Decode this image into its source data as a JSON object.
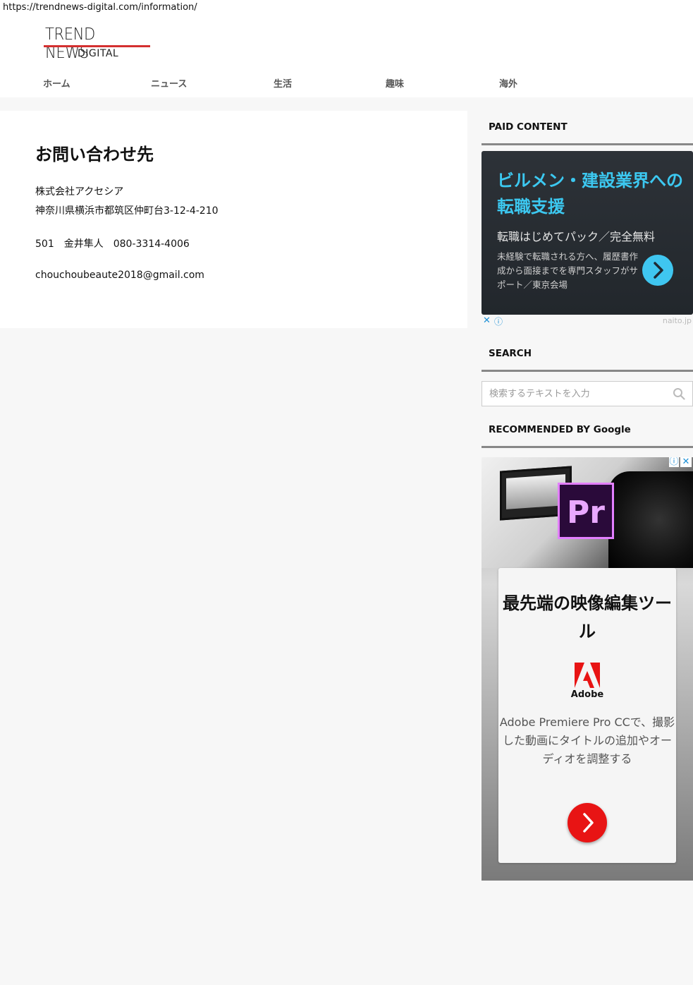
{
  "browser": {
    "url": "https://trendnews-digital.com/information/"
  },
  "site": {
    "logo_top": "TREND NEWS",
    "logo_bottom": "DIGITAL",
    "logo_accent": "#d43030"
  },
  "nav": {
    "items": [
      {
        "label": "ホーム"
      },
      {
        "label": "ニュース"
      },
      {
        "label": "生活"
      },
      {
        "label": "趣味"
      },
      {
        "label": "海外"
      }
    ]
  },
  "main": {
    "title": "お問い合わせ先",
    "company": "株式会社アクセシア",
    "address": "神奈川県横浜市都筑区仲町台3-12-4-210",
    "contact": "501　金井隼人　080-3314-4006",
    "email": "chouchoubeaute2018@gmail.com"
  },
  "sidebar": {
    "paid_content_title": "PAID CONTENT",
    "ad1": {
      "headline": "ビルメン・建設業界への転職支援",
      "sub": "転職はじめてパック／完全無料",
      "body": "未経験で転職される方へ、履歴書作成から面接までを専門スタッフがサポート／東京会場",
      "button_icon": "chevron-right-icon",
      "close": "✕",
      "info": "ⓘ",
      "brand": "naito.jp",
      "accent": "#3cc8f0"
    },
    "search_title": "SEARCH",
    "search": {
      "placeholder": "検索するテキストを入力",
      "icon": "search-icon"
    },
    "recommended_title": "RECOMMENDED BY Google",
    "ad2": {
      "info": "ⓘ",
      "close": "✕",
      "pr_icon_label": "Pr",
      "headline": "最先端の映像編集ツール",
      "brand_label": "Adobe",
      "body": "Adobe Premiere Pro CCで、撮影した動画にタイトルの追加やオーディオを調整する",
      "button_icon": "chevron-right-icon",
      "button_color": "#e81414"
    }
  }
}
